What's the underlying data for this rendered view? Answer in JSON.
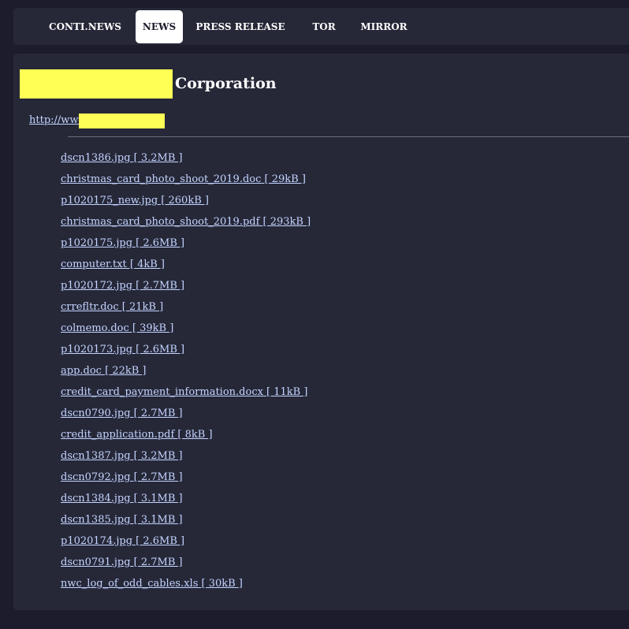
{
  "nav": {
    "items": [
      {
        "label": "CONTI.NEWS"
      },
      {
        "label": "NEWS",
        "active": true
      },
      {
        "label": "PRESS RELEASE"
      },
      {
        "label": "TOR"
      },
      {
        "label": "MIRROR"
      }
    ]
  },
  "company": {
    "title_suffix": "Corporation",
    "url_prefix": "http://www"
  },
  "files": [
    {
      "text": "dscn1386.jpg [ 3.2MB ]"
    },
    {
      "text": "christmas_card_photo_shoot_2019.doc [ 29kB ]"
    },
    {
      "text": "p1020175_new.jpg [ 260kB ]"
    },
    {
      "text": "christmas_card_photo_shoot_2019.pdf [ 293kB ]"
    },
    {
      "text": "p1020175.jpg [ 2.6MB ]"
    },
    {
      "text": "computer.txt [ 4kB ]"
    },
    {
      "text": "p1020172.jpg [ 2.7MB ]"
    },
    {
      "text": "crrefltr.doc [ 21kB ]"
    },
    {
      "text": "colmemo.doc [ 39kB ]"
    },
    {
      "text": "p1020173.jpg [ 2.6MB ]"
    },
    {
      "text": "app.doc [ 22kB ]"
    },
    {
      "text": "credit_card_payment_information.docx [ 11kB ]"
    },
    {
      "text": "dscn0790.jpg [ 2.7MB ]"
    },
    {
      "text": "credit_application.pdf [ 8kB ]"
    },
    {
      "text": "dscn1387.jpg [ 3.2MB ]"
    },
    {
      "text": "dscn0792.jpg [ 2.7MB ]"
    },
    {
      "text": "dscn1384.jpg [ 3.1MB ]"
    },
    {
      "text": "dscn1385.jpg [ 3.1MB ]"
    },
    {
      "text": "p1020174.jpg [ 2.6MB ]"
    },
    {
      "text": "dscn0791.jpg [ 2.7MB ]"
    },
    {
      "text": "nwc_log_of_odd_cables.xls [ 30kB ]"
    }
  ],
  "colors": {
    "page_bg": "#1c1c2c",
    "panel_bg": "#262838",
    "link": "#c4d4ff",
    "redaction": "#ffff55"
  }
}
